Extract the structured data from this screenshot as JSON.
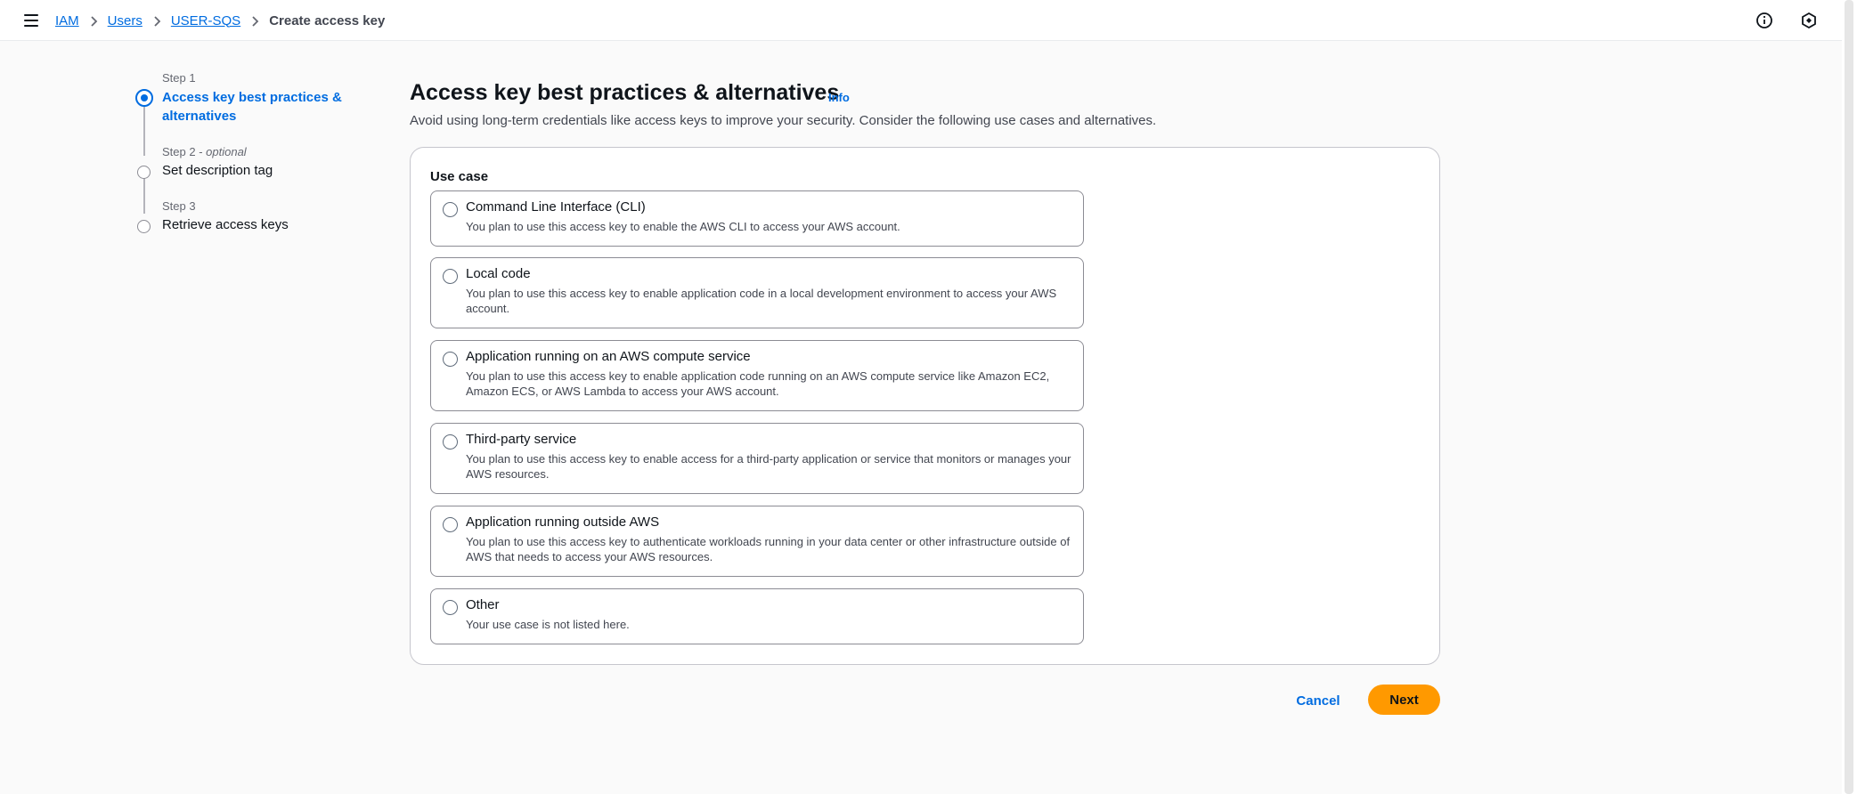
{
  "breadcrumb": {
    "items": [
      "IAM",
      "Users",
      "USER-SQS"
    ],
    "current": "Create access key"
  },
  "icons": {
    "menu": "hamburger-menu-icon",
    "info": "info-circle-icon",
    "settings": "hexagon-settings-icon"
  },
  "steps": [
    {
      "label": "Step 1",
      "optional": "",
      "title": "Access key best practices & alternatives",
      "active": true
    },
    {
      "label": "Step 2",
      "optional": "optional",
      "title": "Set description tag",
      "active": false
    },
    {
      "label": "Step 3",
      "optional": "",
      "title": "Retrieve access keys",
      "active": false
    }
  ],
  "main": {
    "title": "Access key best practices & alternatives",
    "info_link": "Info",
    "description": "Avoid using long-term credentials like access keys to improve your security. Consider the following use cases and alternatives.",
    "use_case_label": "Use case",
    "options": [
      {
        "title": "Command Line Interface (CLI)",
        "desc": "You plan to use this access key to enable the AWS CLI to access your AWS account."
      },
      {
        "title": "Local code",
        "desc": "You plan to use this access key to enable application code in a local development environment to access your AWS account."
      },
      {
        "title": "Application running on an AWS compute service",
        "desc": "You plan to use this access key to enable application code running on an AWS compute service like Amazon EC2, Amazon ECS, or AWS Lambda to access your AWS account."
      },
      {
        "title": "Third-party service",
        "desc": "You plan to use this access key to enable access for a third-party application or service that monitors or manages your AWS resources."
      },
      {
        "title": "Application running outside AWS",
        "desc": "You plan to use this access key to authenticate workloads running in your data center or other infrastructure outside of AWS that needs to access your AWS resources."
      },
      {
        "title": "Other",
        "desc": "Your use case is not listed here."
      }
    ]
  },
  "footer": {
    "cancel_label": "Cancel",
    "next_label": "Next"
  },
  "colors": {
    "link": "#006ce0",
    "primary_button": "#ff9900",
    "border": "#8c8c94"
  }
}
